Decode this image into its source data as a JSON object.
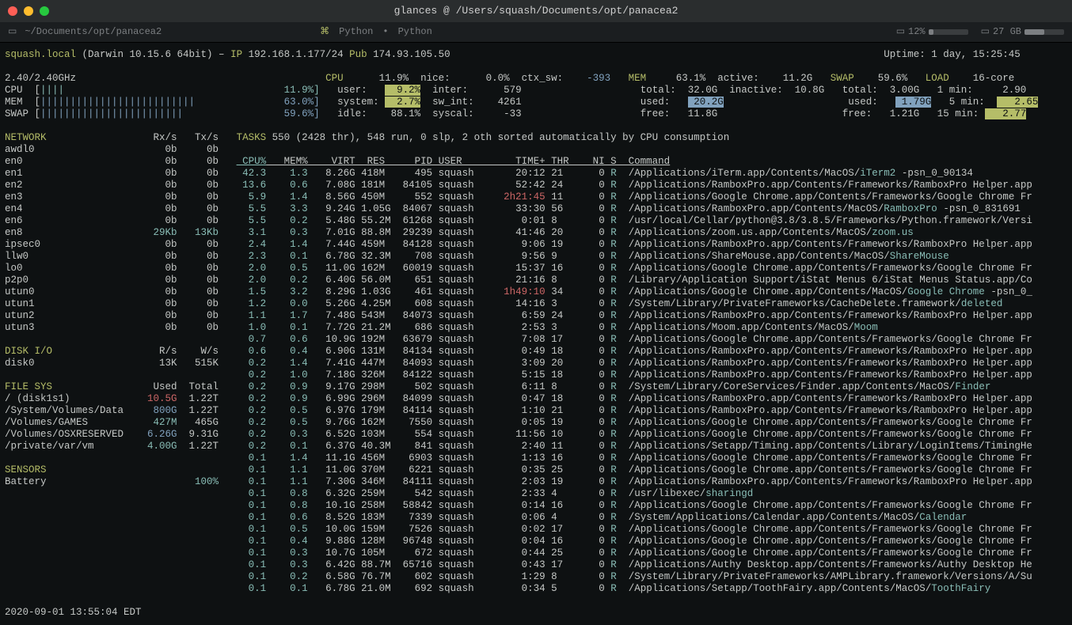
{
  "window": {
    "title": "glances  @  /Users/squash/Documents/opt/panacea2"
  },
  "tabbar": {
    "path": "~/Documents/opt/panacea2",
    "lang_left": "Python",
    "lang_right": "Python",
    "cpu_pct": "12%",
    "disk": "27 GB"
  },
  "header": {
    "host": "squash.local",
    "os": " (Darwin 10.15.6 64bit) – ",
    "ip_lbl": "IP",
    "ip": " 192.168.1.177/24 ",
    "pub_lbl": "Pub",
    "pub": " 174.93.105.50",
    "uptime": "Uptime: 1 day, 15:25:45"
  },
  "quick": {
    "freq": "2.40/2.40GHz",
    "cpu_lbl": "CPU  [",
    "cpu_bar": "||||",
    "cpu_pct": "11.9%]",
    "mem_lbl": "MEM  [",
    "mem_bar": "||||||||||||||||||||||||||",
    "mem_pct": "63.0%]",
    "swap_lbl": "SWAP [",
    "swap_bar": "||||||||||||||||||||||||",
    "swap_pct": "59.6%]"
  },
  "cpu": {
    "hdr": "CPU",
    "hdr_v": "11.9%",
    "user": "user:",
    "user_v": "  9.2%",
    "sys": "system:",
    "sys_v": "  2.7%",
    "idle": "idle:",
    "idle_v": "88.1%",
    "nice": "nice:",
    "nice_v": "0.0%",
    "inter": "inter:",
    "inter_v": "579",
    "swint": "sw_int:",
    "swint_v": "4261",
    "syscal": "syscal:",
    "syscal_v": "-33",
    "ctx": "ctx_sw:",
    "ctx_v": "-393"
  },
  "mem": {
    "hdr": "MEM",
    "hdr_v": "63.1%",
    "total": "total:",
    "total_v": "32.0G",
    "used": "used:",
    "used_v": " 20.2G",
    "free": "free:",
    "free_v": "11.8G",
    "active": "active:",
    "active_v": "11.2G",
    "inactive": "inactive:",
    "inactive_v": "10.8G"
  },
  "swap": {
    "hdr": "SWAP",
    "hdr_v": "59.6%",
    "total": "total:",
    "total_v": "3.00G",
    "used": "used:",
    "used_v": " 1.79G",
    "free": "free:",
    "free_v": "1.21G"
  },
  "load": {
    "hdr": "LOAD",
    "core": "16-core",
    "m1": "1 min:",
    "m1_v": "2.90",
    "m5": "5 min:",
    "m5_v": " 2.65",
    "m15": "15 min:",
    "m15_v": " 2.77"
  },
  "net": {
    "hdr": "NETWORK",
    "rx": "Rx/s",
    "tx": "Tx/s",
    "rows": [
      [
        "awdl0",
        "0b",
        "0b"
      ],
      [
        "en0",
        "0b",
        "0b"
      ],
      [
        "en1",
        "0b",
        "0b"
      ],
      [
        "en2",
        "0b",
        "0b"
      ],
      [
        "en3",
        "0b",
        "0b"
      ],
      [
        "en4",
        "0b",
        "0b"
      ],
      [
        "en6",
        "0b",
        "0b"
      ],
      [
        "en8",
        "29Kb",
        "13Kb"
      ],
      [
        "ipsec0",
        "0b",
        "0b"
      ],
      [
        "llw0",
        "0b",
        "0b"
      ],
      [
        "lo0",
        "0b",
        "0b"
      ],
      [
        "p2p0",
        "0b",
        "0b"
      ],
      [
        "utun0",
        "0b",
        "0b"
      ],
      [
        "utun1",
        "0b",
        "0b"
      ],
      [
        "utun2",
        "0b",
        "0b"
      ],
      [
        "utun3",
        "0b",
        "0b"
      ]
    ]
  },
  "disk": {
    "hdr": "DISK I/O",
    "r": "R/s",
    "w": "W/s",
    "rows": [
      [
        "disk0",
        "13K",
        "515K"
      ]
    ]
  },
  "fs": {
    "hdr": "FILE SYS",
    "u": "Used",
    "t": "Total",
    "rows": [
      [
        "/ (disk1s1)",
        "10.5G",
        "1.22T",
        "r"
      ],
      [
        "/System/Volumes/Data",
        "800G",
        "1.22T",
        "c"
      ],
      [
        "/Volumes/GAMES",
        "427M",
        "465G",
        "g"
      ],
      [
        "/Volumes/OSXRESERVED",
        "6.26G",
        "9.31G",
        "c"
      ],
      [
        "/private/var/vm",
        "4.00G",
        "1.22T",
        "g"
      ]
    ]
  },
  "sensors": {
    "hdr": "SENSORS",
    "row": [
      "Battery",
      "100%"
    ]
  },
  "tasks": {
    "summary": "TASKS 550 (2428 thr), 548 run, 0 slp, 2 oth sorted automatically by CPU consumption",
    "cols": " CPU%   MEM%    VIRT  RES     PID USER         TIME+ THR    NI S  Command",
    "rows": [
      [
        "42.3",
        "1.3",
        "8.26G",
        "418M",
        "495",
        "squash",
        "20:12",
        "21",
        "0",
        "R",
        "/Applications/iTerm.app/Contents/MacOS/",
        "iTerm2",
        " -psn_0_90134",
        ""
      ],
      [
        "13.6",
        "0.6",
        "7.08G",
        "181M",
        "84105",
        "squash",
        "52:42",
        "24",
        "0",
        "R",
        "/Applications/RamboxPro.app/Contents/Frameworks/RamboxPro Helper.app",
        "",
        "",
        ""
      ],
      [
        "5.9",
        "1.4",
        "8.56G",
        "450M",
        "552",
        "squash",
        "2h21:45",
        "11",
        "0",
        "R",
        "/Applications/Google Chrome.app/Contents/Frameworks/Google Chrome Fr",
        "",
        "",
        "r"
      ],
      [
        "5.5",
        "3.3",
        "9.24G",
        "1.05G",
        "84067",
        "squash",
        "33:30",
        "56",
        "0",
        "R",
        "/Applications/RamboxPro.app/Contents/MacOS/",
        "RamboxPro",
        " -psn_0_831691",
        ""
      ],
      [
        "5.5",
        "0.2",
        "5.48G",
        "55.2M",
        "61268",
        "squash",
        "0:01",
        "8",
        "0",
        "R",
        "/usr/local/Cellar/python@3.8/3.8.5/Frameworks/Python.framework/Versi",
        "",
        "",
        ""
      ],
      [
        "3.1",
        "0.3",
        "7.01G",
        "88.8M",
        "29239",
        "squash",
        "41:46",
        "20",
        "0",
        "R",
        "/Applications/zoom.us.app/Contents/MacOS/",
        "zoom.us",
        "",
        ""
      ],
      [
        "2.4",
        "1.4",
        "7.44G",
        "459M",
        "84128",
        "squash",
        "9:06",
        "19",
        "0",
        "R",
        "/Applications/RamboxPro.app/Contents/Frameworks/RamboxPro Helper.app",
        "",
        "",
        ""
      ],
      [
        "2.3",
        "0.1",
        "6.78G",
        "32.3M",
        "708",
        "squash",
        "9:56",
        "9",
        "0",
        "R",
        "/Applications/ShareMouse.app/Contents/MacOS/",
        "ShareMouse",
        "",
        ""
      ],
      [
        "2.0",
        "0.5",
        "11.0G",
        "162M",
        "60019",
        "squash",
        "15:37",
        "16",
        "0",
        "R",
        "/Applications/Google Chrome.app/Contents/Frameworks/Google Chrome Fr",
        "",
        "",
        ""
      ],
      [
        "2.0",
        "0.2",
        "6.40G",
        "56.0M",
        "651",
        "squash",
        "21:16",
        "8",
        "0",
        "R",
        "/Library/Application Support/iStat Menus 6/iStat Menus Status.app/Co",
        "",
        "",
        ""
      ],
      [
        "1.5",
        "3.2",
        "8.29G",
        "1.03G",
        "461",
        "squash",
        "1h49:10",
        "34",
        "0",
        "R",
        "/Applications/Google Chrome.app/Contents/MacOS/",
        "Google Chrome",
        " -psn_0_",
        "r"
      ],
      [
        "1.2",
        "0.0",
        "5.26G",
        "4.25M",
        "608",
        "squash",
        "14:16",
        "3",
        "0",
        "R",
        "/System/Library/PrivateFrameworks/CacheDelete.framework/",
        "deleted",
        "",
        ""
      ],
      [
        "1.1",
        "1.7",
        "7.48G",
        "543M",
        "84073",
        "squash",
        "6:59",
        "24",
        "0",
        "R",
        "/Applications/RamboxPro.app/Contents/Frameworks/RamboxPro Helper.app",
        "",
        "",
        ""
      ],
      [
        "1.0",
        "0.1",
        "7.72G",
        "21.2M",
        "686",
        "squash",
        "2:53",
        "3",
        "0",
        "R",
        "/Applications/Moom.app/Contents/MacOS/",
        "Moom",
        "",
        ""
      ],
      [
        "0.7",
        "0.6",
        "10.9G",
        "192M",
        "63679",
        "squash",
        "7:08",
        "17",
        "0",
        "R",
        "/Applications/Google Chrome.app/Contents/Frameworks/Google Chrome Fr",
        "",
        "",
        ""
      ],
      [
        "0.6",
        "0.4",
        "6.90G",
        "131M",
        "84134",
        "squash",
        "0:49",
        "18",
        "0",
        "R",
        "/Applications/RamboxPro.app/Contents/Frameworks/RamboxPro Helper.app",
        "",
        "",
        ""
      ],
      [
        "0.2",
        "1.4",
        "7.41G",
        "447M",
        "84093",
        "squash",
        "3:09",
        "20",
        "0",
        "R",
        "/Applications/RamboxPro.app/Contents/Frameworks/RamboxPro Helper.app",
        "",
        "",
        ""
      ],
      [
        "0.2",
        "1.0",
        "7.18G",
        "326M",
        "84122",
        "squash",
        "5:15",
        "18",
        "0",
        "R",
        "/Applications/RamboxPro.app/Contents/Frameworks/RamboxPro Helper.app",
        "",
        "",
        ""
      ],
      [
        "0.2",
        "0.9",
        "9.17G",
        "298M",
        "502",
        "squash",
        "6:11",
        "8",
        "0",
        "R",
        "/System/Library/CoreServices/Finder.app/Contents/MacOS/",
        "Finder",
        "",
        ""
      ],
      [
        "0.2",
        "0.9",
        "6.99G",
        "296M",
        "84099",
        "squash",
        "0:47",
        "18",
        "0",
        "R",
        "/Applications/RamboxPro.app/Contents/Frameworks/RamboxPro Helper.app",
        "",
        "",
        ""
      ],
      [
        "0.2",
        "0.5",
        "6.97G",
        "179M",
        "84114",
        "squash",
        "1:10",
        "21",
        "0",
        "R",
        "/Applications/RamboxPro.app/Contents/Frameworks/RamboxPro Helper.app",
        "",
        "",
        ""
      ],
      [
        "0.2",
        "0.5",
        "9.76G",
        "162M",
        "7550",
        "squash",
        "0:05",
        "19",
        "0",
        "R",
        "/Applications/Google Chrome.app/Contents/Frameworks/Google Chrome Fr",
        "",
        "",
        ""
      ],
      [
        "0.2",
        "0.3",
        "6.52G",
        "103M",
        "554",
        "squash",
        "11:56",
        "10",
        "0",
        "R",
        "/Applications/Google Chrome.app/Contents/Frameworks/Google Chrome Fr",
        "",
        "",
        ""
      ],
      [
        "0.2",
        "0.1",
        "6.37G",
        "40.3M",
        "841",
        "squash",
        "2:40",
        "11",
        "0",
        "R",
        "/Applications/Setapp/Timing.app/Contents/Library/LoginItems/TimingHe",
        "",
        "",
        ""
      ],
      [
        "0.1",
        "1.4",
        "11.1G",
        "456M",
        "6903",
        "squash",
        "1:13",
        "16",
        "0",
        "R",
        "/Applications/Google Chrome.app/Contents/Frameworks/Google Chrome Fr",
        "",
        "",
        ""
      ],
      [
        "0.1",
        "1.1",
        "11.0G",
        "370M",
        "6221",
        "squash",
        "0:35",
        "25",
        "0",
        "R",
        "/Applications/Google Chrome.app/Contents/Frameworks/Google Chrome Fr",
        "",
        "",
        ""
      ],
      [
        "0.1",
        "1.1",
        "7.30G",
        "346M",
        "84111",
        "squash",
        "2:03",
        "19",
        "0",
        "R",
        "/Applications/RamboxPro.app/Contents/Frameworks/RamboxPro Helper.app",
        "",
        "",
        ""
      ],
      [
        "0.1",
        "0.8",
        "6.32G",
        "259M",
        "542",
        "squash",
        "2:33",
        "4",
        "0",
        "R",
        "/usr/libexec/",
        "sharingd",
        "",
        ""
      ],
      [
        "0.1",
        "0.8",
        "10.1G",
        "258M",
        "58842",
        "squash",
        "0:14",
        "16",
        "0",
        "R",
        "/Applications/Google Chrome.app/Contents/Frameworks/Google Chrome Fr",
        "",
        "",
        ""
      ],
      [
        "0.1",
        "0.6",
        "8.52G",
        "183M",
        "7339",
        "squash",
        "0:06",
        "4",
        "0",
        "R",
        "/System/Applications/Calendar.app/Contents/MacOS/",
        "Calendar",
        "",
        ""
      ],
      [
        "0.1",
        "0.5",
        "10.0G",
        "159M",
        "7526",
        "squash",
        "0:02",
        "17",
        "0",
        "R",
        "/Applications/Google Chrome.app/Contents/Frameworks/Google Chrome Fr",
        "",
        "",
        ""
      ],
      [
        "0.1",
        "0.4",
        "9.88G",
        "128M",
        "96748",
        "squash",
        "0:04",
        "16",
        "0",
        "R",
        "/Applications/Google Chrome.app/Contents/Frameworks/Google Chrome Fr",
        "",
        "",
        ""
      ],
      [
        "0.1",
        "0.3",
        "10.7G",
        "105M",
        "672",
        "squash",
        "0:44",
        "25",
        "0",
        "R",
        "/Applications/Google Chrome.app/Contents/Frameworks/Google Chrome Fr",
        "",
        "",
        ""
      ],
      [
        "0.1",
        "0.3",
        "6.42G",
        "88.7M",
        "65716",
        "squash",
        "0:43",
        "17",
        "0",
        "R",
        "/Applications/Authy Desktop.app/Contents/Frameworks/Authy Desktop He",
        "",
        "",
        ""
      ],
      [
        "0.1",
        "0.2",
        "6.58G",
        "76.7M",
        "602",
        "squash",
        "1:29",
        "8",
        "0",
        "R",
        "/System/Library/PrivateFrameworks/AMPLibrary.framework/Versions/A/Su",
        "",
        "",
        ""
      ],
      [
        "0.1",
        "0.1",
        "6.78G",
        "21.0M",
        "692",
        "squash",
        "0:34",
        "5",
        "0",
        "R",
        "/Applications/Setapp/ToothFairy.app/Contents/MacOS/",
        "ToothFairy",
        "",
        ""
      ]
    ]
  },
  "footer": "2020-09-01 13:55:04 EDT"
}
